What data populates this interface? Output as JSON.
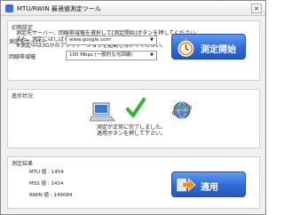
{
  "window": {
    "title": "MTU/RWIN 最適値測定ツール",
    "close_label": "×"
  },
  "settings": {
    "group_title": "初期設定",
    "description": [
      "測定先サーバー、回線帯域幅を選択して[測定開始]ボタンを押してください。",
      "また、測定にはしばらく時間がかかります。",
      "※測定中は3Gかのアプリケーションを起動しないでください。"
    ],
    "server_label": "測定先サーバー",
    "server_value": "www.google.com",
    "band_label": "回線帯域幅",
    "band_value": "100 Mbps (一般的な光回線)",
    "measure_button": "測定開始"
  },
  "progress": {
    "group_title": "進捗状況",
    "status_lines": [
      "測定が正常に完了しました。",
      "適用ボタンを押して下さい。"
    ]
  },
  "results": {
    "group_title": "測定結果",
    "mtu": "MTU 値 : 1454",
    "mss": "MSS 値 : 1414",
    "rwin": "RWIN 値 : 149084",
    "apply_button": "適用"
  },
  "colors": {
    "button_blue": "#2f6bd9",
    "check_green": "#2fb52f",
    "arrow_orange": "#f08a1c"
  },
  "icons": [
    "app-icon",
    "close-icon",
    "chevron-down-icon",
    "stopwatch-icon",
    "pc-icon",
    "checkmark-icon",
    "globe-icon",
    "arrow-right-icon"
  ]
}
